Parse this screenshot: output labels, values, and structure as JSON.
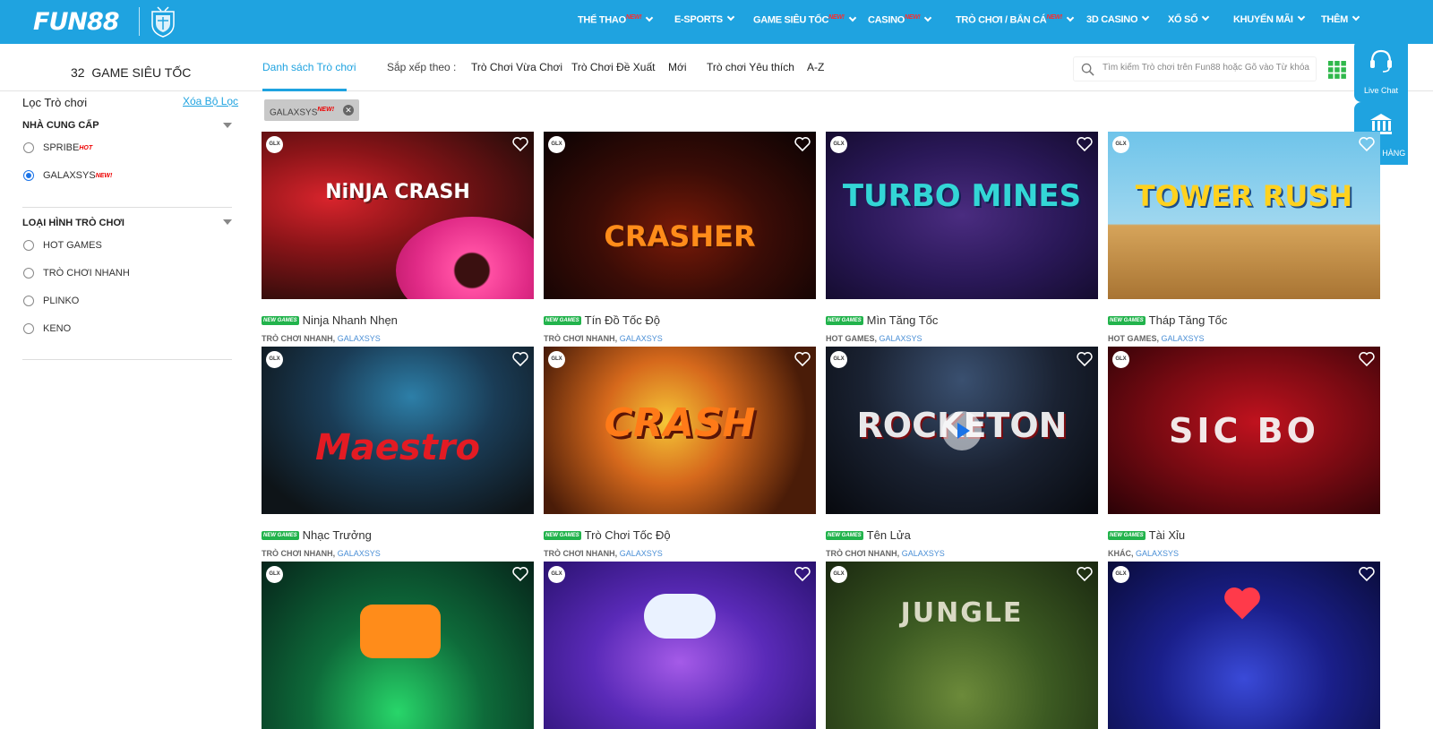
{
  "header": {
    "logo": "FUN88",
    "nav": [
      {
        "label": "THỂ THAO",
        "badge": "NEW!"
      },
      {
        "label": "E-SPORTS",
        "badge": ""
      },
      {
        "label": "GAME SIÊU TỐC",
        "badge": "NEW!"
      },
      {
        "label": "CASINO",
        "badge": "NEW!"
      },
      {
        "label": "TRÒ CHƠI / BẮN CÁ",
        "badge": "NEW!"
      },
      {
        "label": "3D CASINO",
        "badge": ""
      },
      {
        "label": "XỔ SỐ",
        "badge": ""
      },
      {
        "label": "KHUYẾN MÃI",
        "badge": ""
      },
      {
        "label": "THÊM",
        "badge": ""
      }
    ]
  },
  "subbar": {
    "count_title": "32  GAME SIÊU TỐC",
    "tab_active": "Danh sách Trò chơi",
    "sort_label": "Sắp xếp theo :",
    "sort_items": [
      "Trò Chơi Vừa Chơi",
      "Trò Chơi Đề Xuất",
      "Mới",
      "Trò chơi Yêu thích",
      "A-Z"
    ],
    "search_placeholder": "Tìm kiếm Trò chơi trên Fun88 hoặc Gõ vào Từ khóa"
  },
  "side_buttons": {
    "live_chat": "Live Chat",
    "bank": "NGÂN HÀNG"
  },
  "sidebar": {
    "filter_title": "Lọc Trò chơi",
    "clear_label": "Xóa Bộ Lọc",
    "provider_heading": "NHÀ CUNG CẤP",
    "providers": [
      {
        "label": "SPRIBE",
        "badge": "HOT",
        "checked": false
      },
      {
        "label": "GALAXSYS",
        "badge": "NEW!",
        "checked": true
      }
    ],
    "type_heading": "LOẠI HÌNH TRÒ CHƠI",
    "types": [
      {
        "label": "HOT GAMES",
        "checked": false
      },
      {
        "label": "TRÒ CHƠI NHANH",
        "checked": false
      },
      {
        "label": "PLINKO",
        "checked": false
      },
      {
        "label": "KENO",
        "checked": false
      }
    ]
  },
  "active_filter": {
    "label": "GALAXSYS",
    "badge": "NEW!"
  },
  "games": [
    {
      "art": "NiNJA CRASH",
      "name": "Ninja Nhanh Nhẹn",
      "category": "TRÒ CHƠI NHANH,",
      "provider": "GALAXSYS",
      "badge": "NEW GAMES",
      "provider_icon": "GLX"
    },
    {
      "art": "CRASHER",
      "name": "Tín Đồ Tốc Độ",
      "category": "TRÒ CHƠI NHANH,",
      "provider": "GALAXSYS",
      "badge": "NEW GAMES",
      "provider_icon": "GLX"
    },
    {
      "art": "TURBO MINES",
      "name": "Mìn Tăng Tốc",
      "category": "HOT GAMES,",
      "provider": "GALAXSYS",
      "badge": "NEW GAMES",
      "provider_icon": "GLX"
    },
    {
      "art": "TOWER RUSH",
      "name": "Tháp Tăng Tốc",
      "category": "HOT GAMES,",
      "provider": "GALAXSYS",
      "badge": "NEW GAMES",
      "provider_icon": "GLX"
    },
    {
      "art": "Maestro",
      "name": "Nhạc Trưởng",
      "category": "TRÒ CHƠI NHANH,",
      "provider": "GALAXSYS",
      "badge": "NEW GAMES",
      "provider_icon": "GLX"
    },
    {
      "art": "CRASH",
      "name": "Trò Chơi Tốc Độ",
      "category": "TRÒ CHƠI NHANH,",
      "provider": "GALAXSYS",
      "badge": "NEW GAMES",
      "provider_icon": "GLX"
    },
    {
      "art": "ROCKETON",
      "name": "Tên Lửa",
      "category": "TRÒ CHƠI NHANH,",
      "provider": "GALAXSYS",
      "badge": "NEW GAMES",
      "provider_icon": "GLX"
    },
    {
      "art": "SIC BO",
      "name": "Tài Xỉu",
      "category": "KHÁC,",
      "provider": "GALAXSYS",
      "badge": "NEW GAMES",
      "provider_icon": "GLX"
    },
    {
      "art": "",
      "name": "",
      "category": "",
      "provider": "",
      "badge": "",
      "provider_icon": "GLX"
    },
    {
      "art": "",
      "name": "",
      "category": "",
      "provider": "",
      "badge": "",
      "provider_icon": "GLX"
    },
    {
      "art": "JUNGLE",
      "name": "",
      "category": "",
      "provider": "",
      "badge": "",
      "provider_icon": "GLX"
    },
    {
      "art": "",
      "name": "",
      "category": "",
      "provider": "",
      "badge": "",
      "provider_icon": "GLX"
    }
  ]
}
